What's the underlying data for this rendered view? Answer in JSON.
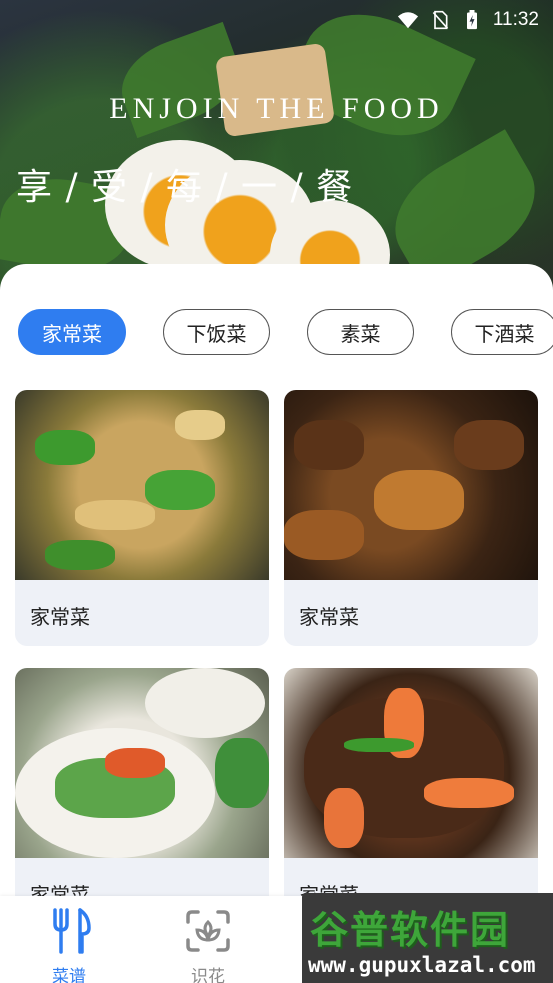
{
  "status_bar": {
    "time": "11:32",
    "icons": [
      "wifi-icon",
      "no-sim-icon",
      "battery-charging-icon"
    ]
  },
  "hero": {
    "title_en": "ENJOIN THE FOOD",
    "title_cn": "享 / 受 / 每 / 一 / 餐"
  },
  "categories": [
    {
      "label": "家常菜",
      "active": true
    },
    {
      "label": "下饭菜",
      "active": false
    },
    {
      "label": "素菜",
      "active": false
    },
    {
      "label": "下酒菜",
      "active": false
    }
  ],
  "recipes": [
    {
      "title": "家常菜"
    },
    {
      "title": "家常菜"
    },
    {
      "title": "家常菜"
    },
    {
      "title": "家常菜"
    }
  ],
  "bottom_nav": [
    {
      "label": "菜谱",
      "icon": "fork-knife-icon",
      "active": true
    },
    {
      "label": "识花",
      "icon": "flower-scan-icon",
      "active": false
    }
  ],
  "watermark": {
    "text": "谷普软件园",
    "url": "www.gupuxlazal.com"
  },
  "colors": {
    "accent": "#2f7df0",
    "card_bg": "#eef1f7",
    "watermark_green": "#3ea63a"
  }
}
